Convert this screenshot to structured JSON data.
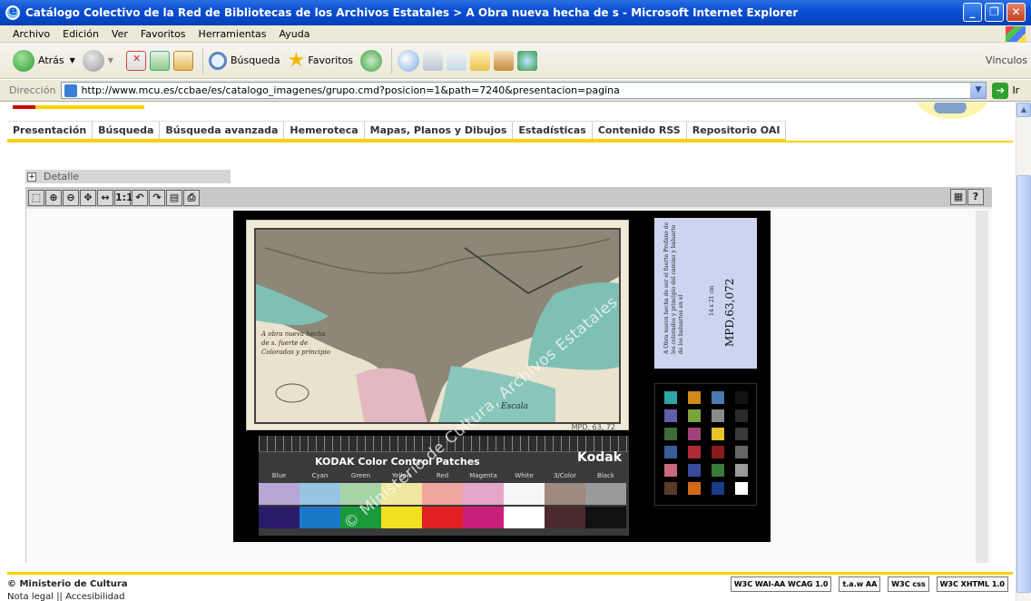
{
  "window": {
    "title": "Catálogo Colectivo de la Red de Bibliotecas de los Archivos Estatales > A Obra nueva hecha de s - Microsoft Internet Explorer",
    "controls": [
      "_",
      "❐",
      "✕"
    ]
  },
  "menu": [
    "Archivo",
    "Edición",
    "Ver",
    "Favoritos",
    "Herramientas",
    "Ayuda"
  ],
  "toolbar": {
    "back_label": "Atrás",
    "search_label": "Búsqueda",
    "favorites_label": "Favoritos",
    "links_label": "Vínculos"
  },
  "address": {
    "label": "Dirección",
    "url": "http://www.mcu.es/ccbae/es/catalogo_imagenes/grupo.cmd?posicion=1&path=7240&presentacion=pagina",
    "go_label": "Ir"
  },
  "nav": [
    "Presentación",
    "Búsqueda",
    "Búsqueda avanzada",
    "Hemeroteca",
    "Mapas, Planos y Dibujos",
    "Estadísticas",
    "Contenido RSS",
    "Repositorio OAI"
  ],
  "detalle": {
    "toggle": "+",
    "label": "Detalle"
  },
  "viewer": {
    "tools": [
      "select-icon",
      "zoom-in-icon",
      "zoom-out-icon",
      "pan-icon",
      "fit-width-icon",
      "actual-size-icon",
      "rotate-left-icon",
      "rotate-right-icon",
      "save-icon",
      "print-icon"
    ],
    "actual_size_text": "1:1",
    "help_text": "?"
  },
  "scan": {
    "map_caption": "A obra nueva hecha de s. fuerte de Colorados y principio",
    "map_scale_label": "Escala",
    "map_ref": "MPD, 63, 72",
    "label_desc": "A Obra nueva hecha de ser el fuerte Profano de los colorados y principio del camino y baluarte de los baluartes en el",
    "label_dim": "14 x 21 cm",
    "label_code": "MPD,63,072",
    "kodak_title": "KODAK Color Control Patches",
    "kodak_brand": "Kodak",
    "kodak_patch_names": [
      "Blue",
      "Cyan",
      "Green",
      "Yellow",
      "Red",
      "Magenta",
      "White",
      "3/Color",
      "Black"
    ],
    "watermark": "© Ministerio de Cultura, Archivos Estatales"
  },
  "footer": {
    "copyright": "© Ministerio de Cultura",
    "links": "Nota legal  ||  Accesibilidad",
    "badges": [
      "W3C WAI-AA WCAG 1.0",
      "t.a.w AA",
      "W3C css",
      "W3C XHTML 1.0"
    ]
  },
  "colors": {
    "accent_yellow": "#fcd000",
    "xp_blue": "#0a4fd4"
  }
}
